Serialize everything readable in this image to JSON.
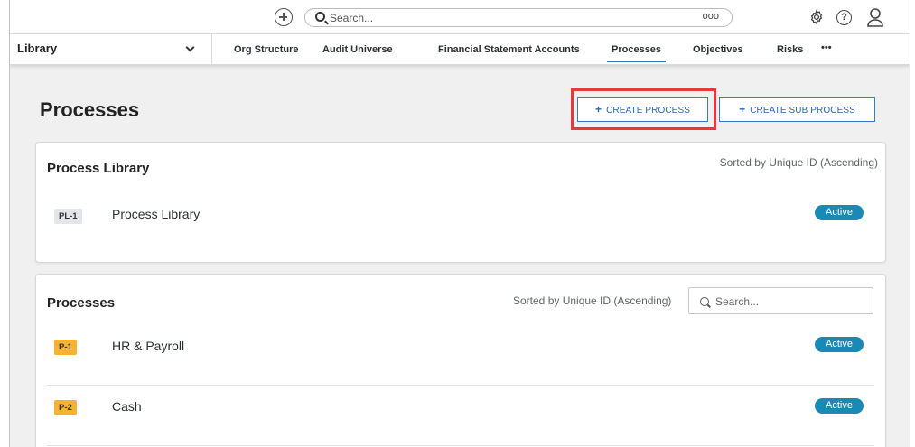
{
  "topbar": {
    "search_placeholder": "Search...",
    "search_more": "ooo"
  },
  "nav": {
    "library_label": "Library",
    "items": [
      {
        "label": "Org Structure"
      },
      {
        "label": "Audit Universe"
      },
      {
        "label": "Financial Statement Accounts"
      },
      {
        "label": "Processes"
      },
      {
        "label": "Objectives"
      },
      {
        "label": "Risks"
      }
    ],
    "more": "•••",
    "active": "Processes"
  },
  "page": {
    "title": "Processes",
    "create_process": "CREATE PROCESS",
    "create_sub_process": "CREATE SUB PROCESS",
    "plus": "+"
  },
  "library_card": {
    "title": "Process Library",
    "sorted": "Sorted by Unique ID (Ascending)",
    "rows": [
      {
        "id": "PL-1",
        "label": "Process Library",
        "status": "Active"
      }
    ]
  },
  "processes_card": {
    "title": "Processes",
    "sorted": "Sorted by Unique ID (Ascending)",
    "search_placeholder": "Search...",
    "rows": [
      {
        "id": "P-1",
        "label": "HR & Payroll",
        "status": "Active"
      },
      {
        "id": "P-2",
        "label": "Cash",
        "status": "Active"
      }
    ]
  },
  "colors": {
    "accent": "#2a64ad",
    "active_badge": "#1a8ab5",
    "highlight": "#e8383d",
    "tag_orange": "#f7b232"
  }
}
